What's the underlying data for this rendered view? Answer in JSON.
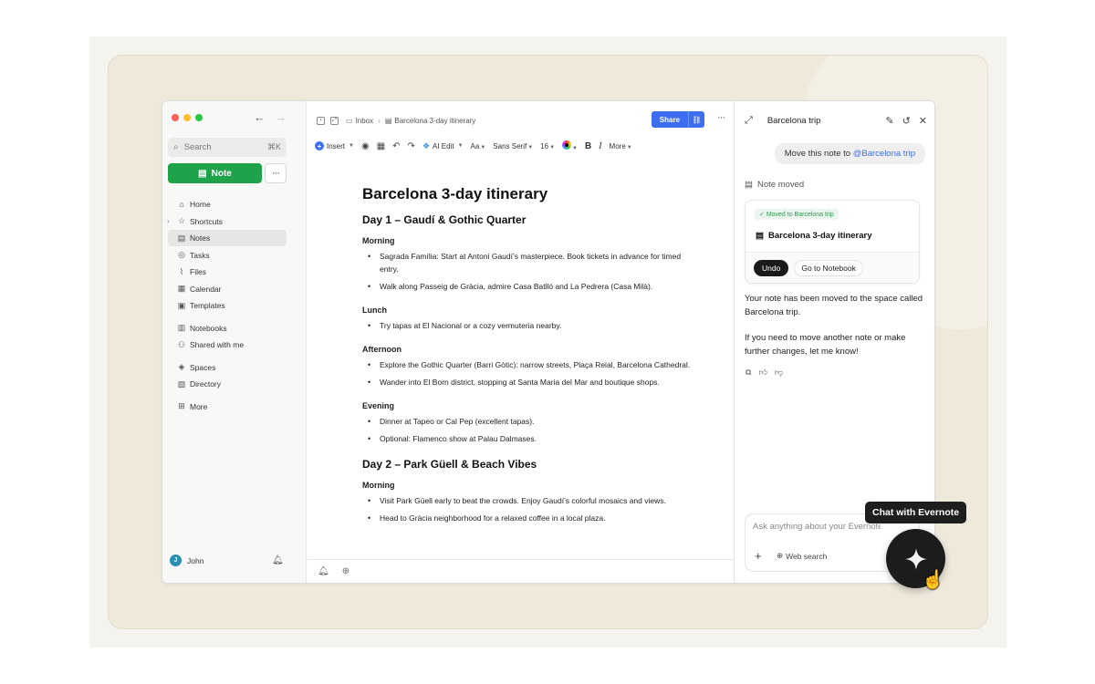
{
  "sidebar": {
    "search_placeholder": "Search",
    "search_shortcut": "⌘K",
    "new_note_label": "Note",
    "more_dots": "···",
    "items": [
      {
        "label": "Home"
      },
      {
        "label": "Shortcuts"
      },
      {
        "label": "Notes"
      },
      {
        "label": "Tasks"
      },
      {
        "label": "Files"
      },
      {
        "label": "Calendar"
      },
      {
        "label": "Templates"
      },
      {
        "label": "Notebooks"
      },
      {
        "label": "Shared with me"
      },
      {
        "label": "Spaces"
      },
      {
        "label": "Directory"
      },
      {
        "label": "More"
      }
    ],
    "user": {
      "name": "John",
      "initial": "J"
    }
  },
  "editor": {
    "breadcrumb": [
      "Inbox",
      "Barcelona 3-day itinerary"
    ],
    "share_label": "Share",
    "toolbar": {
      "insert": "Insert",
      "ai_edit": "AI Edit",
      "text_style": "Aa",
      "font": "Sans Serif",
      "size": "16",
      "more": "More"
    },
    "note": {
      "title": "Barcelona 3-day itinerary",
      "day1": {
        "heading": "Day 1 – Gaudí & Gothic Quarter",
        "morning": "Morning",
        "morning_items": [
          "Sagrada Família: Start at Antoni Gaudí’s masterpiece. Book tickets in advance for timed entry.",
          "Walk along Passeig de Gràcia, admire Casa Batlló and La Pedrera (Casa Milà)."
        ],
        "lunch": "Lunch",
        "lunch_items": [
          " Try tapas at El Nacional or a cozy vermuteria nearby."
        ],
        "afternoon": "Afternoon",
        "afternoon_items": [
          "Explore the Gothic Quarter (Barri Gòtic): narrow streets, Plaça Reial, Barcelona Cathedral.",
          "Wander into El Born district, stopping at Santa Maria del Mar and boutique shops."
        ],
        "evening": "Evening",
        "evening_items": [
          "Dinner at Tapeo or Cal Pep (excellent tapas).",
          "Optional: Flamenco show at Palau Dalmases."
        ]
      },
      "day2": {
        "heading": "Day 2 – Park Güell & Beach Vibes",
        "morning": "Morning",
        "morning_items": [
          "Visit Park Güell early to beat the crowds. Enjoy Gaudí’s colorful mosaics and views.",
          "Head to Gràcia neighborhood for a relaxed coffee in a local plaza."
        ]
      }
    }
  },
  "chat": {
    "title": "Barcelona trip",
    "user_message_prefix": "Move this note to ",
    "user_message_mention": "@Barcelona trip",
    "status": "Note moved",
    "card": {
      "pill": "Moved to Barcelona trip",
      "note_title": "Barcelona 3-day itinerary",
      "undo": "Undo",
      "goto": "Go to Notebook"
    },
    "reply": [
      "Your note has been moved to the space called Barcelona trip.",
      "If you need to move another note or make further changes, let me know!"
    ],
    "input_placeholder": "Ask anything about your Evernote",
    "web_search": "Web search"
  },
  "floating": {
    "tooltip": "Chat with Evernote"
  },
  "colors": {
    "brand_green": "#1fa34a",
    "share_blue": "#3d6ef0",
    "mention_blue": "#3d6ef0"
  }
}
